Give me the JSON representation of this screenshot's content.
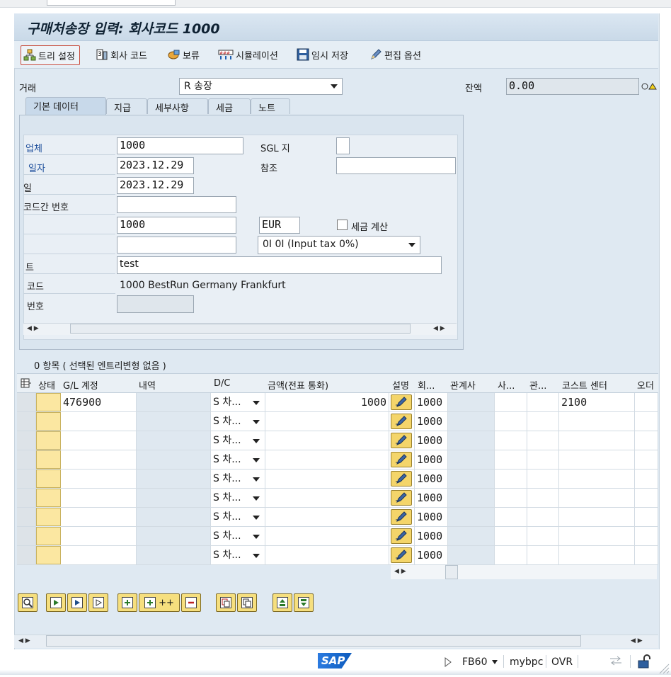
{
  "window": {
    "title": "구매처송장 입력: 회사코드 1000"
  },
  "toolbar": {
    "tree": "트리 설정",
    "company_code": "회사 코드",
    "hold": "보류",
    "simulate": "시뮬레이션",
    "park": "임시 저장",
    "edit_options": "편집 옵션"
  },
  "header": {
    "transaction_label": "거래",
    "transaction_value": "R 송장",
    "balance_label": "잔액",
    "balance_value": "0.00"
  },
  "tabs": [
    {
      "label": "기본 데이터"
    },
    {
      "label": "지급"
    },
    {
      "label": "세부사항"
    },
    {
      "label": "세금"
    },
    {
      "label": "노트"
    }
  ],
  "basic": {
    "vendor_label": "업체",
    "vendor_value": "1000",
    "sgl_label": "SGL 지",
    "date_label": "일자",
    "date_value": "2023.12.29",
    "reference_label": "참조",
    "posting_label": "일",
    "posting_value": "2023.12.29",
    "crosscc_label": "코드간 번호",
    "amount_value": "1000",
    "currency_value": "EUR",
    "calc_tax_label": "세금 계산",
    "tax_code_value": "0I 0I (Input tax 0%)",
    "text_label": "트",
    "text_value": "test",
    "cocode_label": "코드",
    "cocode_value": "1000 BestRun Germany Frankfurt",
    "number_label": "번호"
  },
  "items": {
    "title": "0 항목 ( 선택된 엔트리변형 없음 )",
    "columns": {
      "status": "상태",
      "gl": "G/L 계정",
      "desc": "내역",
      "dc": "D/C",
      "amount": "금액(전표 통화)",
      "note": "설명",
      "cocode": "회...",
      "partner": "관계사",
      "biz": "사...",
      "rel": "관...",
      "cost": "코스트 센터",
      "order": "오더"
    },
    "rows": [
      {
        "gl": "476900",
        "dc": "S 차...",
        "amount": "1000",
        "cocode": "1000",
        "cost": "2100"
      },
      {
        "gl": "",
        "dc": "S 차...",
        "amount": "",
        "cocode": "1000",
        "cost": ""
      },
      {
        "gl": "",
        "dc": "S 차...",
        "amount": "",
        "cocode": "1000",
        "cost": ""
      },
      {
        "gl": "",
        "dc": "S 차...",
        "amount": "",
        "cocode": "1000",
        "cost": ""
      },
      {
        "gl": "",
        "dc": "S 차...",
        "amount": "",
        "cocode": "1000",
        "cost": ""
      },
      {
        "gl": "",
        "dc": "S 차...",
        "amount": "",
        "cocode": "1000",
        "cost": ""
      },
      {
        "gl": "",
        "dc": "S 차...",
        "amount": "",
        "cocode": "1000",
        "cost": ""
      },
      {
        "gl": "",
        "dc": "S 차...",
        "amount": "",
        "cocode": "1000",
        "cost": ""
      },
      {
        "gl": "",
        "dc": "S 차...",
        "amount": "",
        "cocode": "1000",
        "cost": ""
      }
    ]
  },
  "bottom_buttons": {
    "plus_plus": "++"
  },
  "statusbar": {
    "logo": "SAP",
    "transaction": "FB60",
    "system": "mybpc",
    "mode": "OVR"
  }
}
